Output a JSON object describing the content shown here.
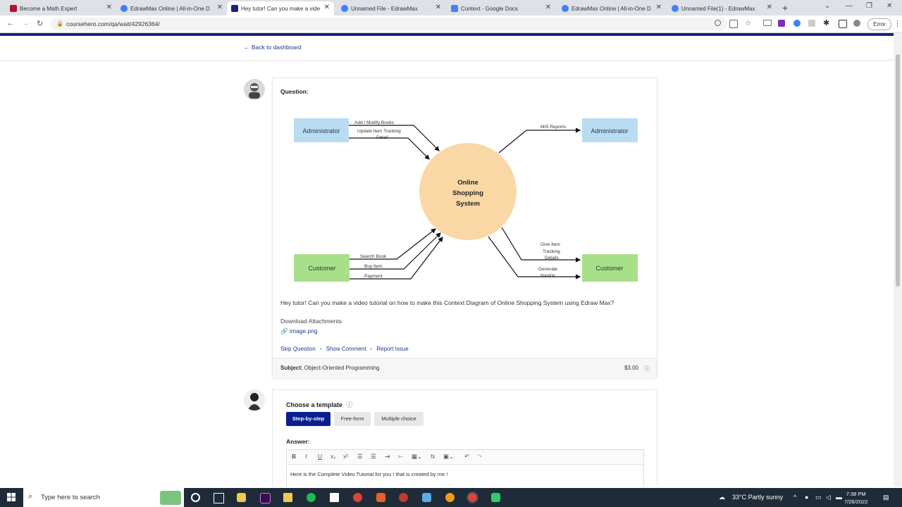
{
  "browser": {
    "tabs": [
      {
        "title": "Become a Math Expert",
        "color": "#b5122b"
      },
      {
        "title": "EdrawMax Online | All-in-One D",
        "color": "#3b82f6"
      },
      {
        "title": "Hey tutor! Can you make a vide",
        "color": "#1a237e"
      },
      {
        "title": "Unnamed File - EdrawMax",
        "color": "#3b82f6"
      },
      {
        "title": "Context - Google Docs",
        "color": "#4285f4"
      },
      {
        "title": "EdrawMax Online | All-in-One D",
        "color": "#3b82f6"
      },
      {
        "title": "Unnamed File(1) - EdrawMax",
        "color": "#3b82f6"
      }
    ],
    "url": "coursehero.com/qa/wait/42926364/",
    "error_label": "Error"
  },
  "page": {
    "back_link": "Back to dashboard",
    "question_label": "Question:",
    "diagram": {
      "center_label": [
        "Online",
        "Shopping",
        "System"
      ],
      "admin_left": "Administrator",
      "admin_right": "Administrator",
      "customer_left": "Customer",
      "customer_right": "Customer",
      "flow_add_modify": "Add / Modify Books",
      "flow_update_tracking": "Update Item Tracking",
      "flow_update_tracking_2": "Detail",
      "flow_mis_reports": "MIS Reports",
      "flow_search_book": "Search Book",
      "flow_buy_item": "Buy Item",
      "flow_payment": "Payment",
      "flow_give_tracking": [
        "Give Item",
        "Tracking",
        "Details"
      ],
      "flow_generate_invoice": [
        "Generate",
        "Invoice"
      ]
    },
    "question_text": "Hey tutor! Can you make a video tutorial on how to make this Context Diagram of Online Shopping System using Edraw Max?",
    "download_label": "Download Attachments",
    "attachment_name": "image.png",
    "actions": {
      "skip": "Skip Question",
      "comment": "Show Comment",
      "report": "Report Issue"
    },
    "subject_label": "Subject:",
    "subject_value": "Object-Oriented Programming",
    "price": "$3.00",
    "choose_template": "Choose a template",
    "templates": [
      "Step-by-step",
      "Free-form",
      "Multiple choice"
    ],
    "answer_label": "Answer:",
    "answer_text": "Here is the Complete Video Tutorial for you ! that is created by me !"
  },
  "taskbar": {
    "search_placeholder": "Type here to search",
    "weather": "33°C  Partly sunny",
    "time": "7:38 PM",
    "date": "7/26/2022"
  },
  "colors": {
    "brand": "#1a237e",
    "admin_box": "#b9dcf3",
    "customer_box": "#a8e08a",
    "center_circle": "#fad8a6"
  }
}
